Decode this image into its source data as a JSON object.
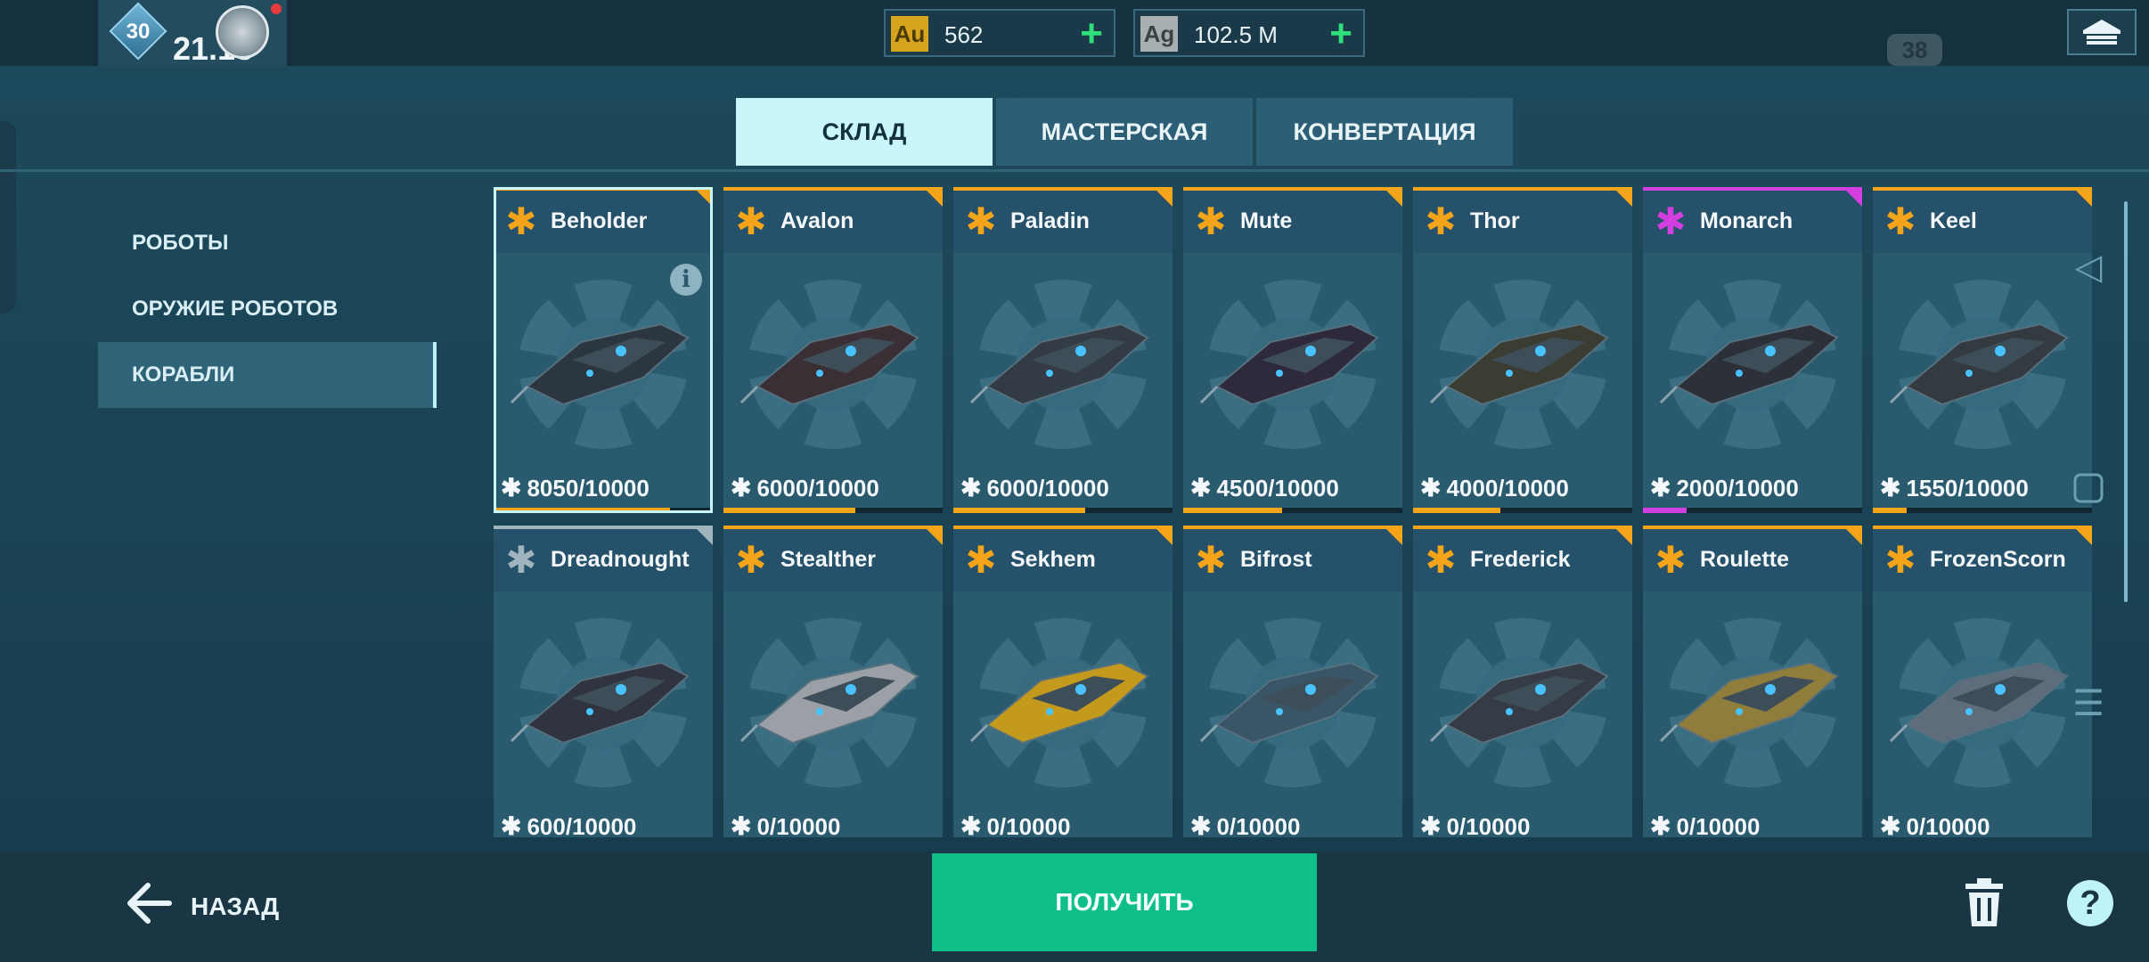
{
  "header": {
    "level": "30",
    "rating": "21.13",
    "gold": {
      "icon_label": "Au",
      "value": "562"
    },
    "silver": {
      "icon_label": "Ag",
      "value": "102.5 M"
    },
    "chat_badge": "38",
    "icons": {
      "hangar": "hangar-icon",
      "plus": "plus-icon",
      "emblem": "clan-emblem-icon"
    }
  },
  "tabs": [
    {
      "label": "СКЛАД",
      "active": true
    },
    {
      "label": "МАСТЕРСКАЯ",
      "active": false
    },
    {
      "label": "КОНВЕРТАЦИЯ",
      "active": false
    }
  ],
  "sidebar": {
    "items": [
      {
        "label": "РОБОТЫ",
        "active": false
      },
      {
        "label": "ОРУЖИЕ РОБОТОВ",
        "active": false
      },
      {
        "label": "КОРАБЛИ",
        "active": true
      }
    ]
  },
  "cards": [
    {
      "name": "Beholder",
      "count": "8050/10000",
      "progress": 0.805,
      "rarity_color": "#f4a418",
      "selected": true
    },
    {
      "name": "Avalon",
      "count": "6000/10000",
      "progress": 0.6,
      "rarity_color": "#f4a418"
    },
    {
      "name": "Paladin",
      "count": "6000/10000",
      "progress": 0.6,
      "rarity_color": "#f4a418"
    },
    {
      "name": "Mute",
      "count": "4500/10000",
      "progress": 0.45,
      "rarity_color": "#f4a418"
    },
    {
      "name": "Thor",
      "count": "4000/10000",
      "progress": 0.4,
      "rarity_color": "#f4a418"
    },
    {
      "name": "Monarch",
      "count": "2000/10000",
      "progress": 0.2,
      "rarity_color": "#d23ee0"
    },
    {
      "name": "Keel",
      "count": "1550/10000",
      "progress": 0.155,
      "rarity_color": "#f4a418"
    },
    {
      "name": "Dreadnought",
      "count": "600/10000",
      "progress": 0.06,
      "rarity_color": "#9fb4bd"
    },
    {
      "name": "Stealther",
      "count": "0/10000",
      "progress": 0,
      "rarity_color": "#f4a418"
    },
    {
      "name": "Sekhem",
      "count": "0/10000",
      "progress": 0,
      "rarity_color": "#f4a418"
    },
    {
      "name": "Bifrost",
      "count": "0/10000",
      "progress": 0,
      "rarity_color": "#f4a418"
    },
    {
      "name": "Frederick",
      "count": "0/10000",
      "progress": 0,
      "rarity_color": "#f4a418"
    },
    {
      "name": "Roulette",
      "count": "0/10000",
      "progress": 0,
      "rarity_color": "#f4a418"
    },
    {
      "name": "FrozenScorn",
      "count": "0/10000",
      "progress": 0,
      "rarity_color": "#f4a418"
    }
  ],
  "footer": {
    "back_label": "НАЗАД",
    "get_label": "ПОЛУЧИТЬ",
    "help_label": "?"
  },
  "colors": {
    "accent": "#0fbf8a",
    "legendary": "#f4a418",
    "epic": "#d23ee0",
    "tab_active": "#c9f6fb"
  }
}
